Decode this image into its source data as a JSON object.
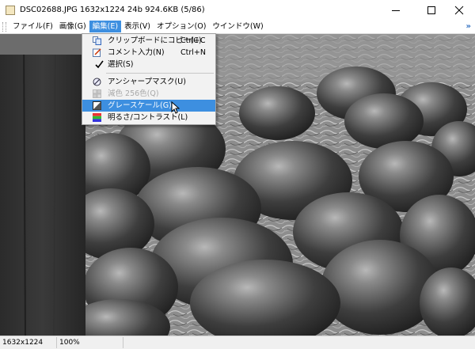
{
  "window": {
    "title": "DSC02688.JPG 1632x1224 24b 924.6KB (5/86)"
  },
  "menu": {
    "items": [
      "ファイル(F)",
      "画像(G)",
      "編集(E)",
      "表示(V)",
      "オプション(O)",
      "ウインドウ(W)"
    ],
    "active_index": 2,
    "overflow": "»"
  },
  "edit_menu": {
    "copy": {
      "label": "クリップボードにコピー(C)",
      "shortcut": "Ctrl+C",
      "icon": "copy-icon"
    },
    "comment": {
      "label": "コメント入力(N)",
      "shortcut": "Ctrl+N",
      "icon": "comment-edit-icon"
    },
    "select": {
      "label": "選択(S)",
      "checked": true
    },
    "sharpen": {
      "label": "アンシャープマスク(U)",
      "icon": "sharpen-icon"
    },
    "reduce_colors": {
      "label": "減色 256色(Q)",
      "enabled": false,
      "icon": "palette-icon"
    },
    "grayscale": {
      "label": "グレースケール(G)",
      "highlighted": true,
      "icon": "grayscale-icon"
    },
    "brightness": {
      "label": "明るさ/コントラスト(L)",
      "icon": "brightness-icon"
    }
  },
  "status": {
    "dimensions": "1632x1224",
    "zoom": "100%"
  },
  "colors": {
    "highlight": "#3d8fe0",
    "menu_bg": "#f2f2f2",
    "disabled": "#a8a8a8"
  }
}
